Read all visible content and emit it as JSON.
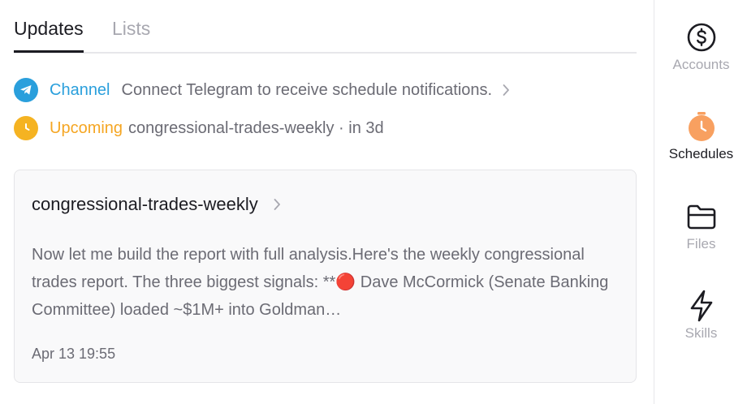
{
  "tabs": [
    {
      "label": "Updates",
      "active": true
    },
    {
      "label": "Lists",
      "active": false
    }
  ],
  "notifications": {
    "channel": {
      "icon": "telegram-icon",
      "keyword": "Channel",
      "text": "Connect Telegram to receive schedule notifications.",
      "color": "#2a9fdc"
    },
    "upcoming": {
      "icon": "clock-icon",
      "keyword": "Upcoming",
      "text": "congressional-trades-weekly · in 3d",
      "color": "#f5a623"
    }
  },
  "card": {
    "title": "congressional-trades-weekly",
    "body": "Now let me build the report with full analysis.Here's the weekly congressional trades report. The three biggest signals: **🔴 Dave McCormick (Senate Banking Committee) loaded ~$1M+ into Goldman…",
    "date": "Apr 13 19:55"
  },
  "sidebar": [
    {
      "label": "Accounts",
      "icon": "dollar-circle-icon",
      "active": false
    },
    {
      "label": "Schedules",
      "icon": "timer-icon",
      "active": true
    },
    {
      "label": "Files",
      "icon": "folder-icon",
      "active": false
    },
    {
      "label": "Skills",
      "icon": "lightning-icon",
      "active": false
    }
  ],
  "colors": {
    "text": "#1c1c22",
    "muted": "#6b6b74",
    "inactive": "#a8a8b0",
    "schedules_accent": "#f8a060"
  }
}
